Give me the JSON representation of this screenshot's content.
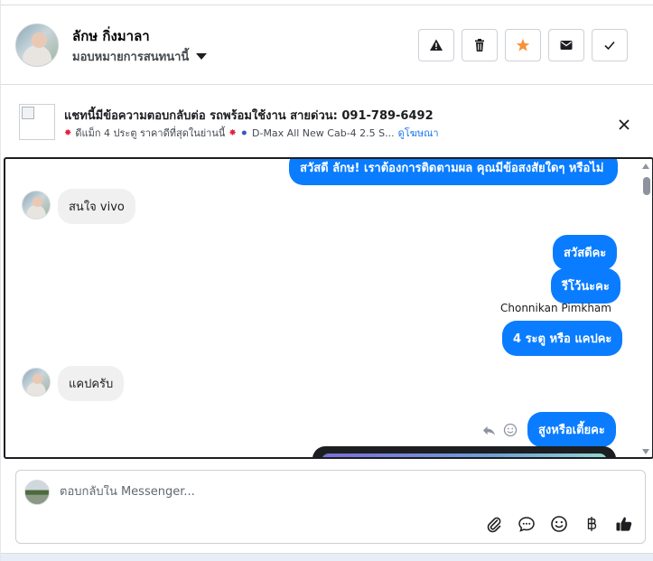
{
  "header": {
    "contact_name": "ลักษ กิ่งมาลา",
    "assign_label": "มอบหมายการสนทนานี้",
    "actions": [
      {
        "name": "report-button",
        "icon": "warning-icon"
      },
      {
        "name": "delete-button",
        "icon": "trash-icon"
      },
      {
        "name": "star-button",
        "icon": "star-icon"
      },
      {
        "name": "mark-unread-button",
        "icon": "envelope-icon"
      },
      {
        "name": "mark-done-button",
        "icon": "check-icon"
      }
    ]
  },
  "ad": {
    "title": "แชทนี้มีข้อความตอบกลับต่อ รถพร้อมใช้งาน สายด่วน: 091-789-6492",
    "subtitle_left": "ดีแม็ก 4 ประตู ราคาดีที่สุดในย่านนี้",
    "subtitle_mid": "D-Max All New Cab-4 2.5 S...",
    "link": "ดูโฆษณา"
  },
  "chat": {
    "top_cutoff_text": "สวัสดี ลักษ! เราต้องการติดตามผล คุณมีข้อสงสัยใดๆ หรือไม่",
    "messages": [
      {
        "dir": "in",
        "text": "สนใจ vivo"
      },
      {
        "dir": "out",
        "text": "สวัสดีคะ"
      },
      {
        "dir": "out",
        "text": "รีโว้นะคะ"
      },
      {
        "dir": "sender",
        "text": "Chonnikan Pimkham"
      },
      {
        "dir": "out",
        "text": "4 ระตู หรือ แคปคะ"
      },
      {
        "dir": "in",
        "text": "แคปครับ"
      },
      {
        "dir": "out",
        "text": "สูงหรือเตี้ยคะ"
      }
    ]
  },
  "composer": {
    "placeholder": "ตอบกลับใน Messenger...",
    "tools": [
      "paperclip-icon",
      "saved-reply-icon",
      "emoji-icon",
      "baht-icon",
      "thumbs-up-icon"
    ]
  },
  "colors": {
    "accent": "#0a7cff",
    "star": "#f7923a",
    "link": "#1877f2"
  }
}
